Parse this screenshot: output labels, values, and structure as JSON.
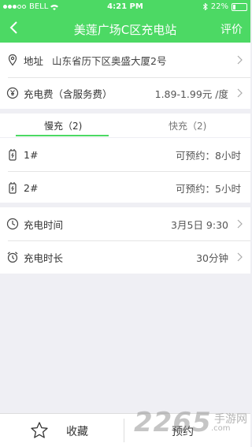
{
  "status_bar": {
    "carrier": "BELL",
    "time": "4:21 PM",
    "battery": "22%",
    "battery_level": 0.22
  },
  "navbar": {
    "title": "美莲广场C区充电站",
    "right_action": "评价"
  },
  "info": {
    "address_label": "地址",
    "address_value": "山东省历下区奥盛大厦2号",
    "fee_label": "充电费（含服务费）",
    "fee_value": "1.89-1.99元 /度"
  },
  "tabs": [
    {
      "label": "慢充（2)"
    },
    {
      "label": "快充（2)"
    }
  ],
  "chargers": [
    {
      "name": "1#",
      "status": "可预约：8小时"
    },
    {
      "name": "2#",
      "status": "可预约：5小时"
    }
  ],
  "settings": {
    "time_label": "充电时间",
    "time_value": "3月5日 9:30",
    "duration_label": "充电时长",
    "duration_value": "30分钟"
  },
  "bottom": {
    "favorite_label": "收藏",
    "book_label": "预约"
  },
  "watermark": {
    "number": "2265",
    "suffix": ".com",
    "brand": "手游网"
  },
  "colors": {
    "accent": "#4cd964"
  }
}
